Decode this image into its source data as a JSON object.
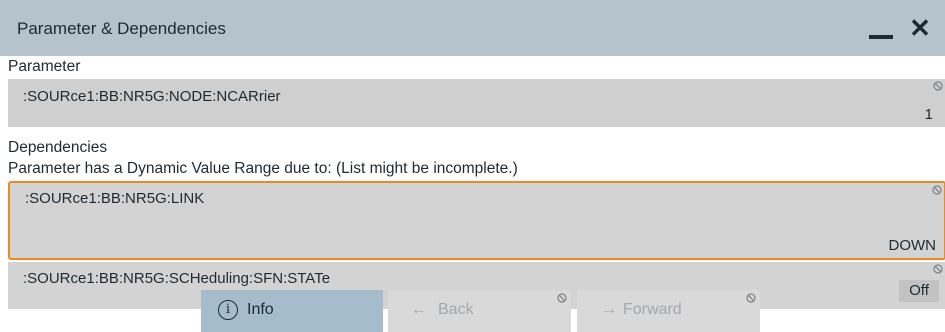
{
  "dialog": {
    "title": "Parameter & Dependencies",
    "minimize_icon": "minimize-icon",
    "close_icon": "close-icon",
    "close_glyph": "✕"
  },
  "parameter": {
    "section_label": "Parameter",
    "command": ":SOURce1:BB:NR5G:NODE:NCARrier",
    "value": "1"
  },
  "dependencies": {
    "section_label": "Dependencies",
    "note": "Parameter has a Dynamic Value Range due to: (List might be incomplete.)",
    "items": [
      {
        "command": ":SOURce1:BB:NR5G:LINK",
        "value": "DOWN",
        "selected": true
      },
      {
        "command": ":SOURce1:BB:NR5G:SCHeduling:SFN:STATe",
        "value": "Off",
        "selected": false
      }
    ]
  },
  "buttons": {
    "info": {
      "label": "Info",
      "icon": "info-icon",
      "glyph": "i"
    },
    "back": {
      "label": "Back",
      "icon": "arrow-left-icon",
      "glyph": "←",
      "disabled": true
    },
    "forward": {
      "label": "Forward",
      "icon": "arrow-right-icon",
      "glyph": "→",
      "disabled": true
    }
  },
  "colors": {
    "titlebar": "#b5c3cd",
    "panel": "#cfcfcf",
    "selection_border": "#e78b22",
    "info_button": "#a4bccc",
    "disabled_button": "#d9d9d9"
  }
}
